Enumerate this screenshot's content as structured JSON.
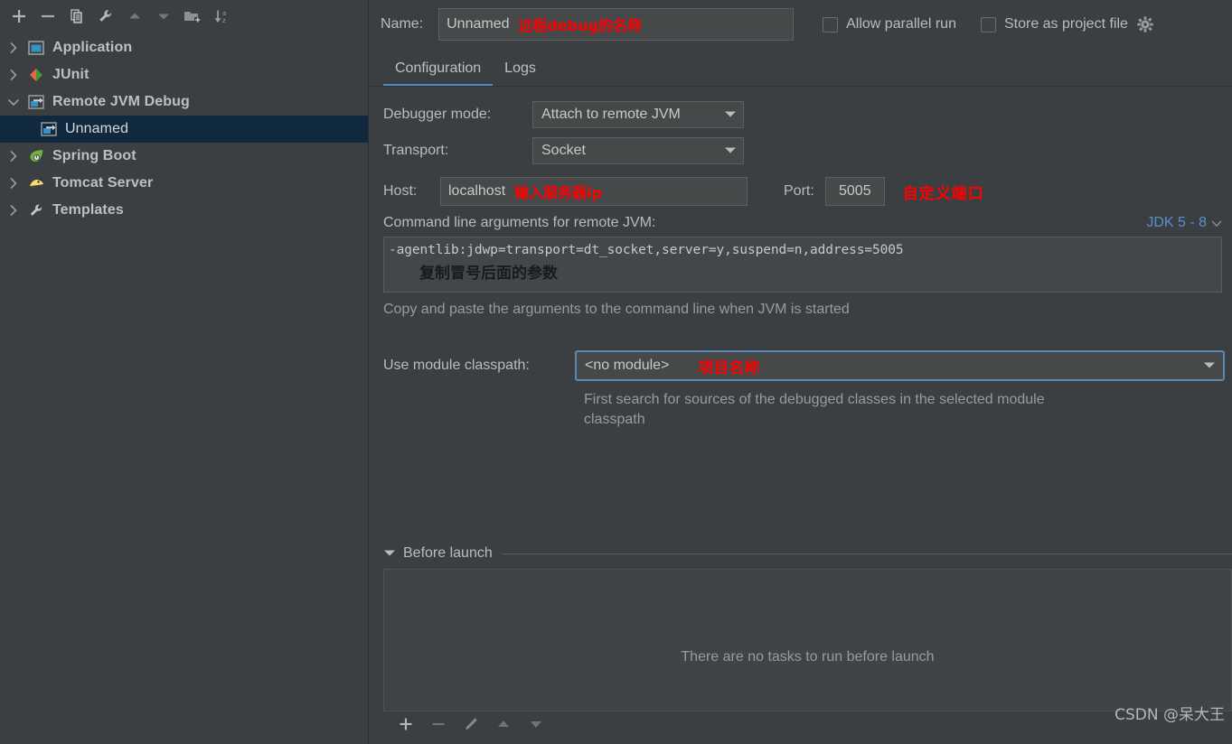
{
  "sidebar": {
    "toolbar": [
      {
        "name": "add-configuration-button",
        "icon": "plus-icon"
      },
      {
        "name": "remove-configuration-button",
        "icon": "minus-icon"
      },
      {
        "name": "copy-configuration-button",
        "icon": "copy-icon"
      },
      {
        "name": "edit-templates-button",
        "icon": "wrench-icon"
      },
      {
        "name": "move-up-button",
        "icon": "arrow-up-icon"
      },
      {
        "name": "move-down-button",
        "icon": "arrow-down-icon"
      },
      {
        "name": "new-folder-button",
        "icon": "folder-add-icon"
      },
      {
        "name": "sort-configurations-button",
        "icon": "sort-az-icon"
      }
    ],
    "tree": [
      {
        "label": "Application",
        "icon": "application-icon",
        "twisty": "collapsed",
        "level": 0,
        "selected": false
      },
      {
        "label": "JUnit",
        "icon": "junit-icon",
        "twisty": "collapsed",
        "level": 0,
        "selected": false
      },
      {
        "label": "Remote JVM Debug",
        "icon": "remote-jvm-icon",
        "twisty": "expanded",
        "level": 0,
        "selected": false
      },
      {
        "label": "Unnamed",
        "icon": "remote-jvm-icon",
        "twisty": "none",
        "level": 1,
        "selected": true
      },
      {
        "label": "Spring Boot",
        "icon": "spring-boot-icon",
        "twisty": "collapsed",
        "level": 0,
        "selected": false
      },
      {
        "label": "Tomcat Server",
        "icon": "tomcat-icon",
        "twisty": "collapsed",
        "level": 0,
        "selected": false
      },
      {
        "label": "Templates",
        "icon": "wrench-icon",
        "twisty": "collapsed",
        "level": 0,
        "selected": false
      }
    ]
  },
  "header": {
    "name_label": "Name:",
    "name_value": "Unnamed",
    "name_annotation": "远程debug的名称",
    "allow_parallel_run_label": "Allow parallel run",
    "allow_parallel_run_checked": false,
    "store_as_project_file_label": "Store as project file",
    "store_as_project_file_checked": false,
    "gear_icon": "gear-icon"
  },
  "tabs": [
    {
      "label": "Configuration",
      "active": true
    },
    {
      "label": "Logs",
      "active": false
    }
  ],
  "configuration": {
    "debugger_mode": {
      "label": "Debugger mode:",
      "value": "Attach to remote JVM"
    },
    "transport": {
      "label": "Transport:",
      "value": "Socket"
    },
    "host": {
      "label": "Host:",
      "value": "localhost",
      "annotation": "输入服务器ip"
    },
    "port": {
      "label": "Port:",
      "value": "5005",
      "annotation": "自定义端口"
    },
    "args": {
      "title": "Command line arguments for remote JVM:",
      "jdk_selector": "JDK 5 - 8",
      "value": "-agentlib:jdwp=transport=dt_socket,server=y,suspend=n,address=5005",
      "annotation": "复制冒号后面的参数",
      "hint": "Copy and paste the arguments to the command line when JVM is started"
    },
    "module_classpath": {
      "label": "Use module classpath:",
      "value": "<no module>",
      "annotation": "项目名称",
      "hint": "First search for sources of the debugged classes in the selected module classpath"
    }
  },
  "before_launch": {
    "title": "Before launch",
    "empty_text": "There are no tasks to run before launch",
    "toolbar": [
      {
        "name": "add-task-button",
        "icon": "plus-icon"
      },
      {
        "name": "remove-task-button",
        "icon": "minus-icon"
      },
      {
        "name": "edit-task-button",
        "icon": "pencil-icon"
      },
      {
        "name": "move-task-up-button",
        "icon": "arrow-up-icon"
      },
      {
        "name": "move-task-down-button",
        "icon": "arrow-down-icon"
      }
    ]
  },
  "watermark": "CSDN @呆大王",
  "colors": {
    "background": "#3c3f41",
    "selection": "#11293f",
    "tab_accent": "#4a88c7",
    "link": "#5a8ed0",
    "focus_border": "#5d87b5",
    "annotation_red": "#ff0000"
  }
}
